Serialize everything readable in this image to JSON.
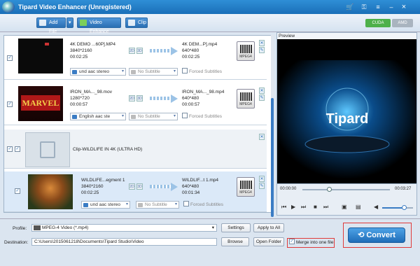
{
  "window": {
    "title": "Tipard Video Enhancer (Unregistered)"
  },
  "toolbar": {
    "add_file": "Add File",
    "video_enhance": "Video Enhance",
    "clip": "Clip",
    "cuda": "CUDA",
    "amd": "AMD"
  },
  "items": [
    {
      "name": "4K DEMO ...60P].MP4",
      "res": "3840*2160",
      "dur": "00:02:25",
      "out_name": "4K DEM...P].mp4",
      "out_res": "640*480",
      "out_dur": "00:02:25",
      "audio": "und aac stereo",
      "subtitle": "No Subtitle",
      "forced": "Forced Subtitles",
      "fmt": "MPEG4"
    },
    {
      "name": "IRON_MA..._98.mov",
      "res": "1280*720",
      "dur": "00:00:57",
      "out_name": "IRON_MA..._98.mp4",
      "out_res": "640*480",
      "out_dur": "00:00:57",
      "audio": "English aac ste",
      "subtitle": "No Subtitle",
      "forced": "Forced Subtitles",
      "fmt": "MPEG4",
      "thumb": "MARVEL"
    },
    {
      "group": "Clip-WILDLIFE IN 4K (ULTRA HD)"
    },
    {
      "name": "WILDLIFE...egment 1",
      "res": "3840*2160",
      "dur": "00:02:25",
      "out_name": "WILDLIF...t 1.mp4",
      "out_res": "640*480",
      "out_dur": "00:01:34",
      "audio": "und aac stereo",
      "subtitle": "No Subtitle",
      "forced": "Forced Subtitles",
      "fmt": "MPEG4"
    }
  ],
  "preview": {
    "label": "Preview",
    "brand": "Tipard",
    "time_start": "00:00:00",
    "time_end": "00:03:27",
    "progress": 0.3,
    "volume": 0.7
  },
  "bottom": {
    "profile_label": "Profile:",
    "profile_value": "MPEG-4 Video (*.mp4)",
    "settings": "Settings",
    "apply_all": "Apply to All",
    "destination_label": "Destination:",
    "destination_value": "C:\\Users\\2015061218\\Documents\\Tipard Studio\\Video",
    "browse": "Browse",
    "open_folder": "Open Folder",
    "merge": "Merge into one file",
    "convert": "Convert"
  }
}
